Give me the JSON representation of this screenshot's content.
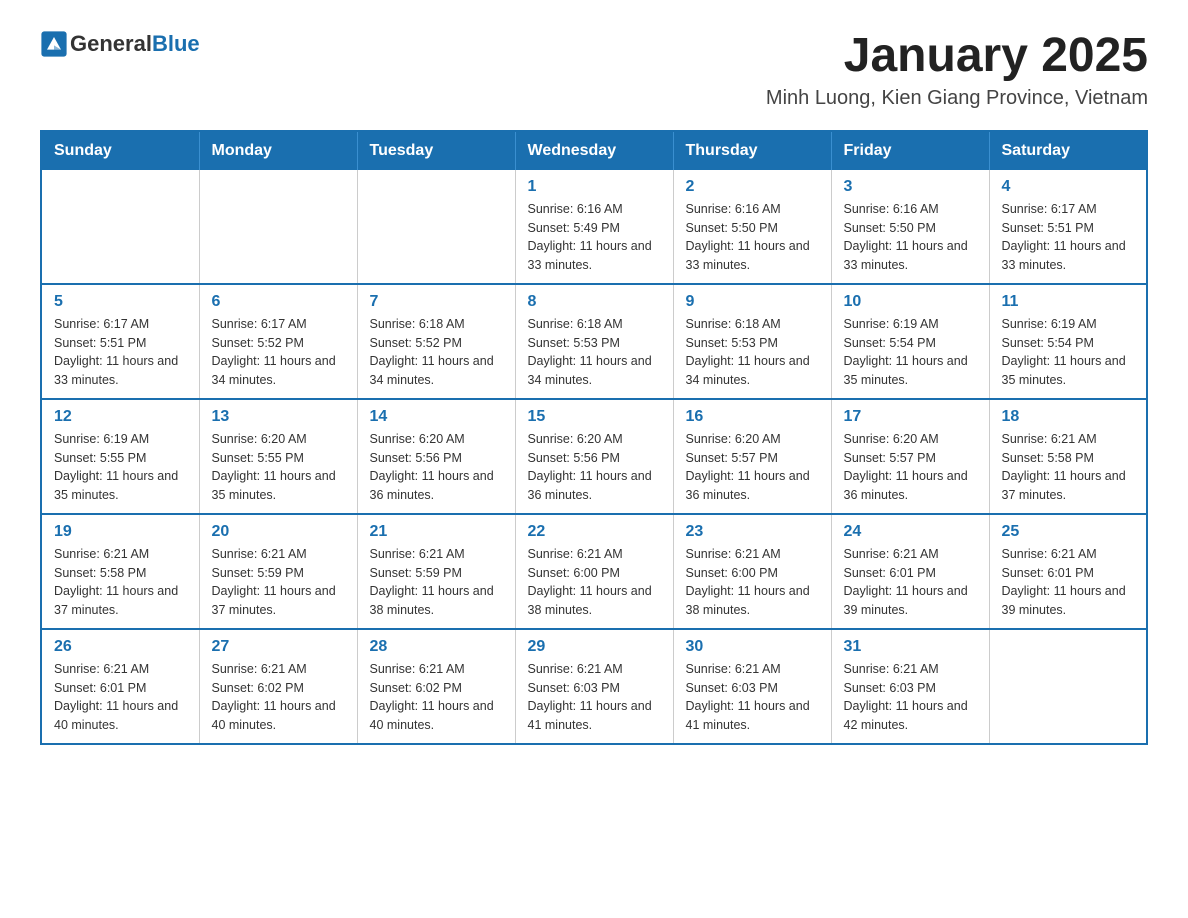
{
  "header": {
    "logo_general": "General",
    "logo_blue": "Blue",
    "title": "January 2025",
    "subtitle": "Minh Luong, Kien Giang Province, Vietnam"
  },
  "weekdays": [
    "Sunday",
    "Monday",
    "Tuesday",
    "Wednesday",
    "Thursday",
    "Friday",
    "Saturday"
  ],
  "weeks": [
    [
      {
        "day": "",
        "info": ""
      },
      {
        "day": "",
        "info": ""
      },
      {
        "day": "",
        "info": ""
      },
      {
        "day": "1",
        "info": "Sunrise: 6:16 AM\nSunset: 5:49 PM\nDaylight: 11 hours and 33 minutes."
      },
      {
        "day": "2",
        "info": "Sunrise: 6:16 AM\nSunset: 5:50 PM\nDaylight: 11 hours and 33 minutes."
      },
      {
        "day": "3",
        "info": "Sunrise: 6:16 AM\nSunset: 5:50 PM\nDaylight: 11 hours and 33 minutes."
      },
      {
        "day": "4",
        "info": "Sunrise: 6:17 AM\nSunset: 5:51 PM\nDaylight: 11 hours and 33 minutes."
      }
    ],
    [
      {
        "day": "5",
        "info": "Sunrise: 6:17 AM\nSunset: 5:51 PM\nDaylight: 11 hours and 33 minutes."
      },
      {
        "day": "6",
        "info": "Sunrise: 6:17 AM\nSunset: 5:52 PM\nDaylight: 11 hours and 34 minutes."
      },
      {
        "day": "7",
        "info": "Sunrise: 6:18 AM\nSunset: 5:52 PM\nDaylight: 11 hours and 34 minutes."
      },
      {
        "day": "8",
        "info": "Sunrise: 6:18 AM\nSunset: 5:53 PM\nDaylight: 11 hours and 34 minutes."
      },
      {
        "day": "9",
        "info": "Sunrise: 6:18 AM\nSunset: 5:53 PM\nDaylight: 11 hours and 34 minutes."
      },
      {
        "day": "10",
        "info": "Sunrise: 6:19 AM\nSunset: 5:54 PM\nDaylight: 11 hours and 35 minutes."
      },
      {
        "day": "11",
        "info": "Sunrise: 6:19 AM\nSunset: 5:54 PM\nDaylight: 11 hours and 35 minutes."
      }
    ],
    [
      {
        "day": "12",
        "info": "Sunrise: 6:19 AM\nSunset: 5:55 PM\nDaylight: 11 hours and 35 minutes."
      },
      {
        "day": "13",
        "info": "Sunrise: 6:20 AM\nSunset: 5:55 PM\nDaylight: 11 hours and 35 minutes."
      },
      {
        "day": "14",
        "info": "Sunrise: 6:20 AM\nSunset: 5:56 PM\nDaylight: 11 hours and 36 minutes."
      },
      {
        "day": "15",
        "info": "Sunrise: 6:20 AM\nSunset: 5:56 PM\nDaylight: 11 hours and 36 minutes."
      },
      {
        "day": "16",
        "info": "Sunrise: 6:20 AM\nSunset: 5:57 PM\nDaylight: 11 hours and 36 minutes."
      },
      {
        "day": "17",
        "info": "Sunrise: 6:20 AM\nSunset: 5:57 PM\nDaylight: 11 hours and 36 minutes."
      },
      {
        "day": "18",
        "info": "Sunrise: 6:21 AM\nSunset: 5:58 PM\nDaylight: 11 hours and 37 minutes."
      }
    ],
    [
      {
        "day": "19",
        "info": "Sunrise: 6:21 AM\nSunset: 5:58 PM\nDaylight: 11 hours and 37 minutes."
      },
      {
        "day": "20",
        "info": "Sunrise: 6:21 AM\nSunset: 5:59 PM\nDaylight: 11 hours and 37 minutes."
      },
      {
        "day": "21",
        "info": "Sunrise: 6:21 AM\nSunset: 5:59 PM\nDaylight: 11 hours and 38 minutes."
      },
      {
        "day": "22",
        "info": "Sunrise: 6:21 AM\nSunset: 6:00 PM\nDaylight: 11 hours and 38 minutes."
      },
      {
        "day": "23",
        "info": "Sunrise: 6:21 AM\nSunset: 6:00 PM\nDaylight: 11 hours and 38 minutes."
      },
      {
        "day": "24",
        "info": "Sunrise: 6:21 AM\nSunset: 6:01 PM\nDaylight: 11 hours and 39 minutes."
      },
      {
        "day": "25",
        "info": "Sunrise: 6:21 AM\nSunset: 6:01 PM\nDaylight: 11 hours and 39 minutes."
      }
    ],
    [
      {
        "day": "26",
        "info": "Sunrise: 6:21 AM\nSunset: 6:01 PM\nDaylight: 11 hours and 40 minutes."
      },
      {
        "day": "27",
        "info": "Sunrise: 6:21 AM\nSunset: 6:02 PM\nDaylight: 11 hours and 40 minutes."
      },
      {
        "day": "28",
        "info": "Sunrise: 6:21 AM\nSunset: 6:02 PM\nDaylight: 11 hours and 40 minutes."
      },
      {
        "day": "29",
        "info": "Sunrise: 6:21 AM\nSunset: 6:03 PM\nDaylight: 11 hours and 41 minutes."
      },
      {
        "day": "30",
        "info": "Sunrise: 6:21 AM\nSunset: 6:03 PM\nDaylight: 11 hours and 41 minutes."
      },
      {
        "day": "31",
        "info": "Sunrise: 6:21 AM\nSunset: 6:03 PM\nDaylight: 11 hours and 42 minutes."
      },
      {
        "day": "",
        "info": ""
      }
    ]
  ]
}
